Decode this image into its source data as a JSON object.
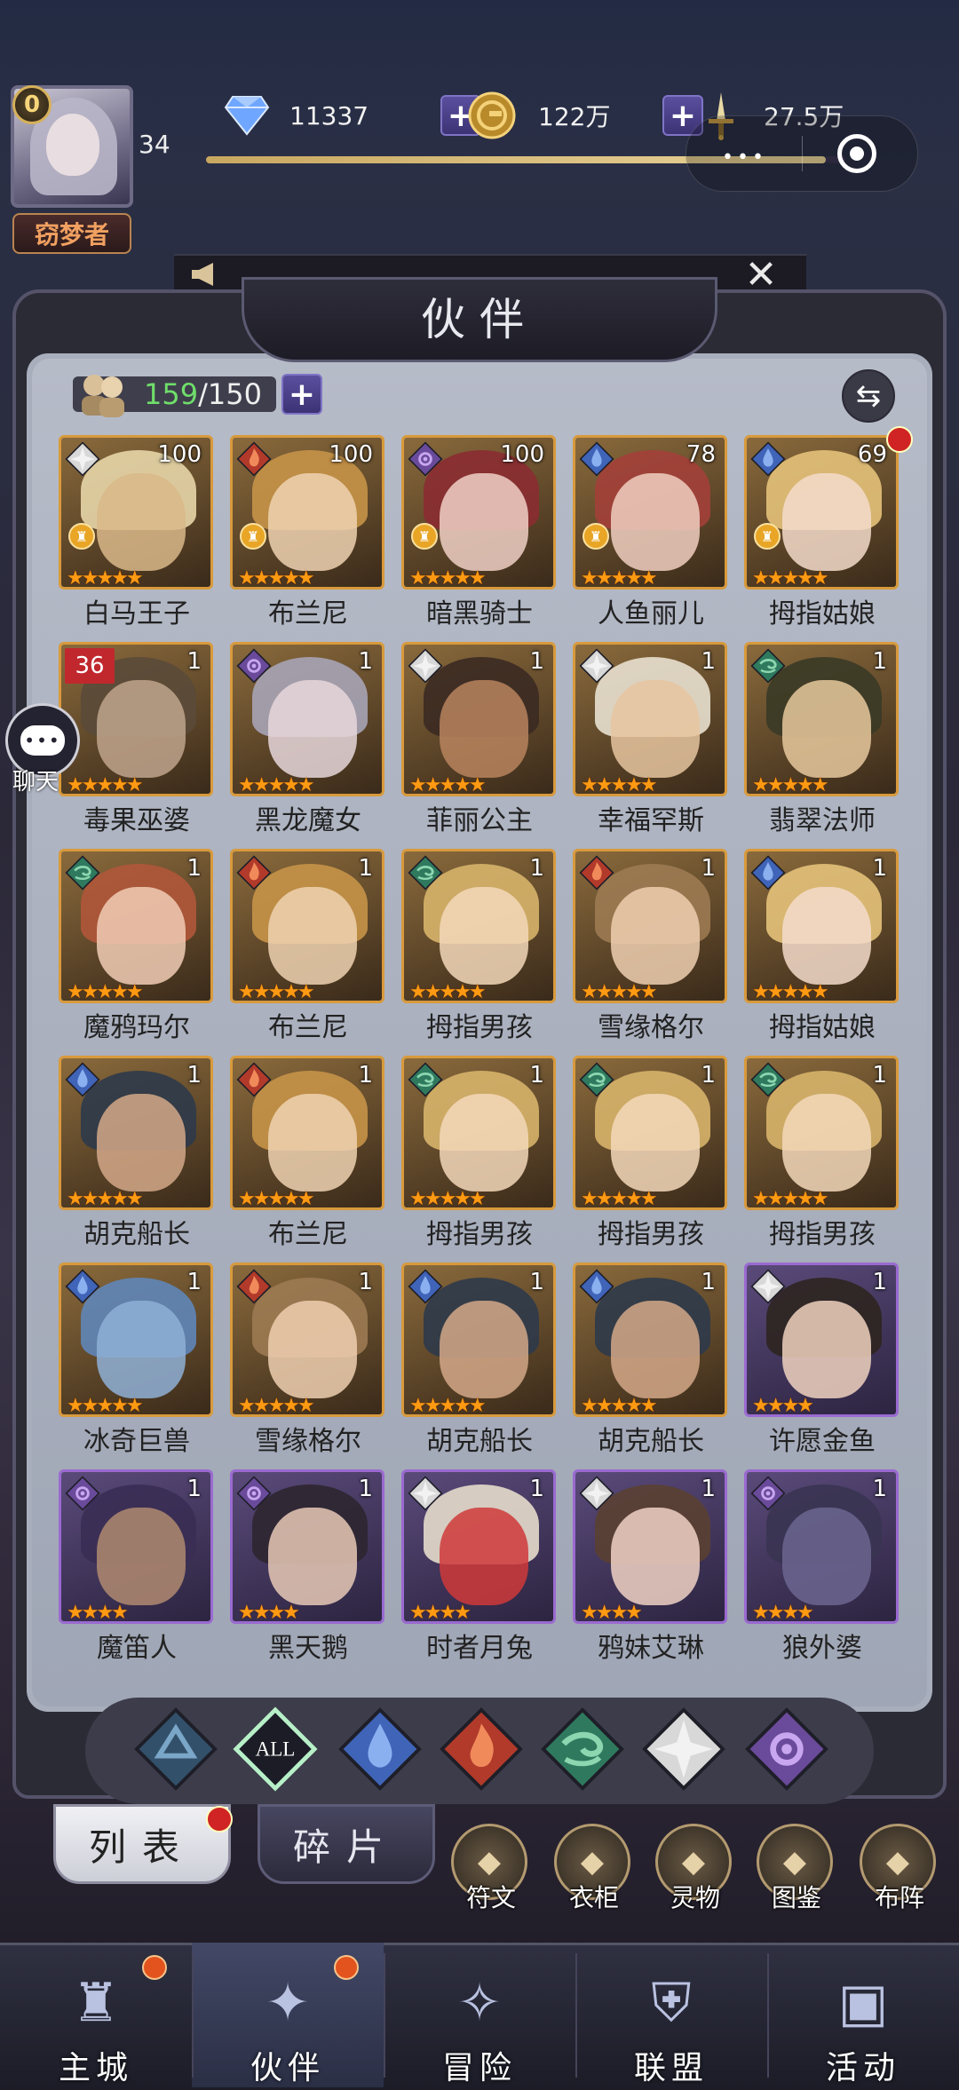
{
  "player": {
    "vip": "0",
    "level": "34",
    "title": "窃梦者",
    "xp_progress": 0.97
  },
  "resources": {
    "diamonds": "11337",
    "gold": "122万",
    "power": "27.5万"
  },
  "capsule": {
    "more": "•••"
  },
  "header": {
    "title": "伙伴"
  },
  "roster": {
    "current": "159",
    "max": "/150"
  },
  "chat": {
    "label": "聊天",
    "bubble": "•••"
  },
  "colors": {
    "gold_frame": "#d89a3c",
    "purple_frame": "#9a6ad0",
    "star": "#ff9a12",
    "count_green": "#6fde6a",
    "reddot": "#d02424"
  },
  "heroes": [
    {
      "name": "白马王子",
      "level": "100",
      "element": "light",
      "stars": 5,
      "rank": true,
      "frame": "gold",
      "colors": [
        "#e7d6a8",
        "#d9b98a"
      ]
    },
    {
      "name": "布兰尼",
      "level": "100",
      "element": "fire",
      "stars": 5,
      "rank": true,
      "frame": "gold",
      "colors": [
        "#c79448",
        "#efd2b2"
      ]
    },
    {
      "name": "暗黑骑士",
      "level": "100",
      "element": "dark",
      "stars": 5,
      "rank": true,
      "frame": "gold",
      "colors": [
        "#8b2c32",
        "#f0d0c6"
      ]
    },
    {
      "name": "人鱼丽儿",
      "level": "78",
      "element": "water",
      "stars": 5,
      "rank": true,
      "frame": "gold",
      "colors": [
        "#a3403a",
        "#f0cfc1"
      ]
    },
    {
      "name": "拇指姑娘",
      "level": "69",
      "element": "water",
      "stars": 5,
      "rank": true,
      "frame": "gold",
      "colors": [
        "#e4c27a",
        "#f4dccb"
      ],
      "reddot": true
    },
    {
      "name": "毒果巫婆",
      "level": "1",
      "element": "none",
      "stars": 5,
      "frame": "gold",
      "badge": "36",
      "colors": [
        "#5a4a38",
        "#bfa58c"
      ]
    },
    {
      "name": "黑龙魔女",
      "level": "1",
      "element": "dark",
      "stars": 5,
      "frame": "gold",
      "colors": [
        "#a7a4b6",
        "#e6d7db"
      ]
    },
    {
      "name": "菲丽公主",
      "level": "1",
      "element": "light",
      "stars": 5,
      "frame": "gold",
      "colors": [
        "#3b2a22",
        "#b9845e"
      ]
    },
    {
      "name": "幸福罕斯",
      "level": "1",
      "element": "light",
      "stars": 5,
      "frame": "gold",
      "colors": [
        "#e8e0cf",
        "#e6c6a0"
      ]
    },
    {
      "name": "翡翠法师",
      "level": "1",
      "element": "wind",
      "stars": 5,
      "frame": "gold",
      "colors": [
        "#3a3a26",
        "#e8c99e"
      ]
    },
    {
      "name": "魔鸦玛尔",
      "level": "1",
      "element": "wind",
      "stars": 5,
      "frame": "gold",
      "colors": [
        "#b0573a",
        "#f1cdb5"
      ]
    },
    {
      "name": "布兰尼",
      "level": "1",
      "element": "fire",
      "stars": 5,
      "frame": "gold",
      "colors": [
        "#c79448",
        "#efd2b2"
      ]
    },
    {
      "name": "拇指男孩",
      "level": "1",
      "element": "wind",
      "stars": 5,
      "frame": "gold",
      "colors": [
        "#d7b46a",
        "#f3d8ba"
      ]
    },
    {
      "name": "雪缘格尔",
      "level": "1",
      "element": "fire",
      "stars": 5,
      "frame": "gold",
      "colors": [
        "#9c7a52",
        "#efcfb0"
      ]
    },
    {
      "name": "拇指姑娘",
      "level": "1",
      "element": "water",
      "stars": 5,
      "frame": "gold",
      "colors": [
        "#e4c27a",
        "#f4dccb"
      ]
    },
    {
      "name": "胡克船长",
      "level": "1",
      "element": "water",
      "stars": 5,
      "frame": "gold",
      "colors": [
        "#2d3a4a",
        "#d3a888"
      ]
    },
    {
      "name": "布兰尼",
      "level": "1",
      "element": "fire",
      "stars": 5,
      "frame": "gold",
      "colors": [
        "#c79448",
        "#efd2b2"
      ]
    },
    {
      "name": "拇指男孩",
      "level": "1",
      "element": "wind",
      "stars": 5,
      "frame": "gold",
      "colors": [
        "#d7b46a",
        "#f3d8ba"
      ]
    },
    {
      "name": "拇指男孩",
      "level": "1",
      "element": "wind",
      "stars": 5,
      "frame": "gold",
      "colors": [
        "#d7b46a",
        "#f3d8ba"
      ]
    },
    {
      "name": "拇指男孩",
      "level": "1",
      "element": "wind",
      "stars": 5,
      "frame": "gold",
      "colors": [
        "#d7b46a",
        "#f3d8ba"
      ]
    },
    {
      "name": "冰奇巨兽",
      "level": "1",
      "element": "water",
      "stars": 5,
      "frame": "gold",
      "colors": [
        "#5f86b8",
        "#8fb0d6"
      ]
    },
    {
      "name": "雪缘格尔",
      "level": "1",
      "element": "fire",
      "stars": 5,
      "frame": "gold",
      "colors": [
        "#9c7a52",
        "#efcfb0"
      ]
    },
    {
      "name": "胡克船长",
      "level": "1",
      "element": "water",
      "stars": 5,
      "frame": "gold",
      "colors": [
        "#2d3a4a",
        "#d3a888"
      ]
    },
    {
      "name": "胡克船长",
      "level": "1",
      "element": "water",
      "stars": 5,
      "frame": "gold",
      "colors": [
        "#2d3a4a",
        "#d3a888"
      ]
    },
    {
      "name": "许愿金鱼",
      "level": "1",
      "element": "light",
      "stars": 4,
      "frame": "purple",
      "colors": [
        "#2e2520",
        "#f0d2c0"
      ]
    },
    {
      "name": "魔笛人",
      "level": "1",
      "element": "dark",
      "stars": 4,
      "frame": "purple",
      "colors": [
        "#3a2e54",
        "#b08a70"
      ]
    },
    {
      "name": "黑天鹅",
      "level": "1",
      "element": "dark",
      "stars": 4,
      "frame": "purple",
      "colors": [
        "#2d2630",
        "#e8c9b6"
      ]
    },
    {
      "name": "时者月兔",
      "level": "1",
      "element": "light",
      "stars": 4,
      "frame": "purple",
      "colors": [
        "#e6dccb",
        "#cf3a3a"
      ]
    },
    {
      "name": "鸦妹艾琳",
      "level": "1",
      "element": "light",
      "stars": 4,
      "frame": "purple",
      "colors": [
        "#5a4032",
        "#f0d2c4"
      ]
    },
    {
      "name": "狼外婆",
      "level": "1",
      "element": "dark",
      "stars": 4,
      "frame": "purple",
      "colors": [
        "#3a3452",
        "#6c6690"
      ]
    }
  ],
  "filters": [
    {
      "id": "shadow",
      "label": ""
    },
    {
      "id": "all",
      "label": "ALL"
    },
    {
      "id": "water",
      "label": ""
    },
    {
      "id": "fire",
      "label": ""
    },
    {
      "id": "wind",
      "label": ""
    },
    {
      "id": "light",
      "label": ""
    },
    {
      "id": "dark",
      "label": ""
    }
  ],
  "tabs": {
    "list": "列表",
    "fragments": "碎片"
  },
  "functions": [
    {
      "label": "符文",
      "icon": "rune-icon"
    },
    {
      "label": "衣柜",
      "icon": "wardrobe-icon"
    },
    {
      "label": "灵物",
      "icon": "spirit-icon"
    },
    {
      "label": "图鉴",
      "icon": "codex-icon"
    },
    {
      "label": "布阵",
      "icon": "formation-icon"
    }
  ],
  "nav": [
    {
      "label": "主城",
      "icon": "castle-icon",
      "dot": true
    },
    {
      "label": "伙伴",
      "icon": "partner-icon",
      "dot": true,
      "active": true
    },
    {
      "label": "冒险",
      "icon": "compass-icon"
    },
    {
      "label": "联盟",
      "icon": "shield-icon"
    },
    {
      "label": "活动",
      "icon": "cards-icon"
    }
  ]
}
